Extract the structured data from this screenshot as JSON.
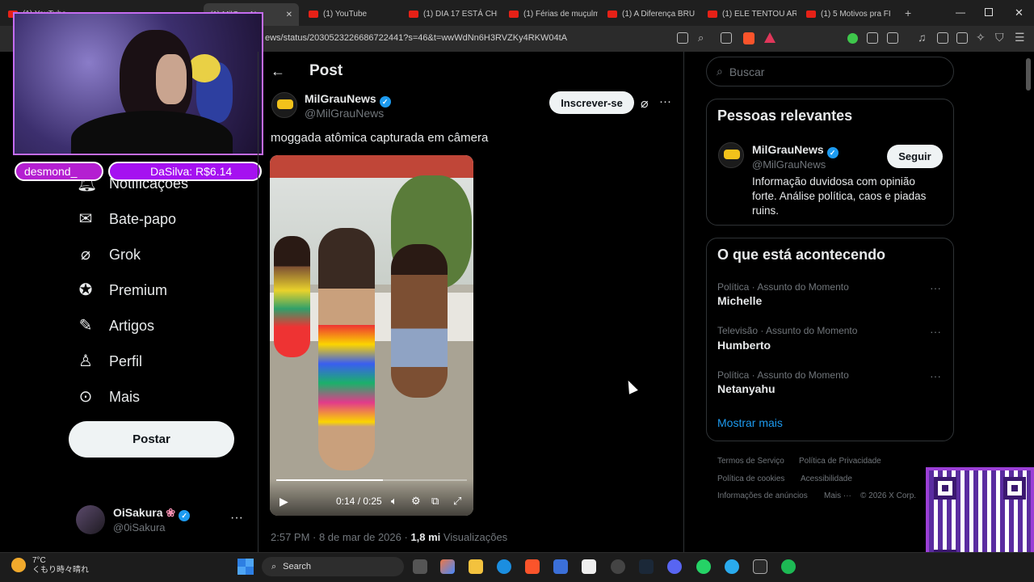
{
  "browser": {
    "tabs": [
      {
        "label": "(1) YouTube"
      },
      {
        "label": "(1) DIA 17 ESTÁ CHE"
      },
      {
        "label": "(1) Férias de muçulm"
      },
      {
        "label": "(1) A Diferença BRU"
      },
      {
        "label": "(1) ELE TENTOU AR"
      },
      {
        "label": "(1) 5 Motivos pra FI"
      }
    ],
    "url": "ews/status/2030523226686722441?s=46&t=wwWdNn6H3RVZKy4RKW04tA"
  },
  "stream_overlay": {
    "donor_sticker": "desmond_",
    "donation_sticker": "DaSilva: R$6.14"
  },
  "sidebar": {
    "items": [
      {
        "label": "Notificações",
        "icon": "bell-icon"
      },
      {
        "label": "Bate-papo",
        "icon": "mail-icon"
      },
      {
        "label": "Grok",
        "icon": "grok-icon"
      },
      {
        "label": "Premium",
        "icon": "premium-icon"
      },
      {
        "label": "Artigos",
        "icon": "articles-icon"
      },
      {
        "label": "Perfil",
        "icon": "person-icon"
      },
      {
        "label": "Mais",
        "icon": "more-circle-icon"
      }
    ],
    "post_button": "Postar",
    "account": {
      "name": "OiSakura",
      "handle": "@0iSakura"
    }
  },
  "post": {
    "header_title": "Post",
    "author_name": "MilGrauNews",
    "author_handle": "@MilGrauNews",
    "subscribe_label": "Inscrever-se",
    "text": "moggada atômica capturada em câmera",
    "video": {
      "time": "0:14 / 0:25",
      "progress_fraction": 0.56
    },
    "timestamp": "2:57 PM · 8 de mar de 2026 ·",
    "views_count": "1,8 mi",
    "views_label": "Visualizações"
  },
  "right": {
    "search_placeholder": "Buscar",
    "relevant": {
      "title": "Pessoas relevantes",
      "name": "MilGrauNews",
      "handle": "@MilGrauNews",
      "follow_label": "Seguir",
      "bio": "Informação duvidosa com opinião forte. Análise política, caos e piadas ruins."
    },
    "trending": {
      "title": "O que está acontecendo",
      "items": [
        {
          "category": "Política · Assunto do Momento",
          "name": "Michelle"
        },
        {
          "category": "Televisão · Assunto do Momento",
          "name": "Humberto"
        },
        {
          "category": "Política · Assunto do Momento",
          "name": "Netanyahu"
        }
      ],
      "show_more": "Mostrar mais"
    },
    "footer": [
      "Termos de Serviço",
      "Política de Privacidade",
      "Política de cookies",
      "Acessibilidade",
      "Informações de anúncios",
      "Mais ···",
      "© 2026 X Corp."
    ]
  },
  "taskbar": {
    "weather_temp": "7°C",
    "weather_desc": "くもり時々晴れ",
    "search_label": "Search"
  },
  "colors": {
    "accent": "#1d9bf0",
    "background": "#000000",
    "sticker": "#a511f0"
  }
}
